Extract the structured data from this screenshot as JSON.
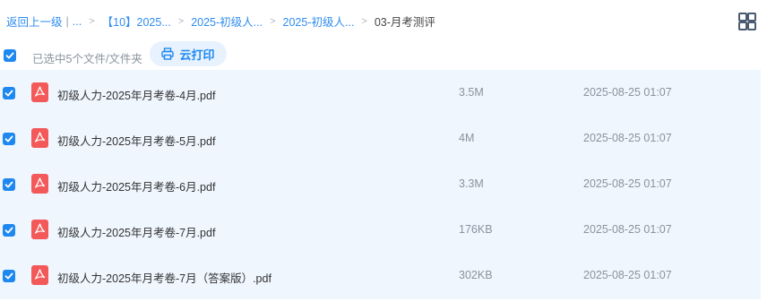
{
  "breadcrumb": {
    "back": "返回上一级",
    "divider": "|",
    "ellipsis": "...",
    "sep": ">",
    "items": [
      "【10】2025...",
      "2025-初级人...",
      "2025-初级人..."
    ],
    "current": "03-月考测评"
  },
  "selection": {
    "text": "已选中5个文件/文件夹",
    "print_label": "云打印"
  },
  "files": [
    {
      "name": "初级人力-2025年月考卷-4月.pdf",
      "size": "3.5M",
      "date": "2025-08-25 01:07"
    },
    {
      "name": "初级人力-2025年月考卷-5月.pdf",
      "size": "4M",
      "date": "2025-08-25 01:07"
    },
    {
      "name": "初级人力-2025年月考卷-6月.pdf",
      "size": "3.3M",
      "date": "2025-08-25 01:07"
    },
    {
      "name": "初级人力-2025年月考卷-7月.pdf",
      "size": "176KB",
      "date": "2025-08-25 01:07"
    },
    {
      "name": "初级人力-2025年月考卷-7月（答案版）.pdf",
      "size": "302KB",
      "date": "2025-08-25 01:07"
    }
  ],
  "colors": {
    "accent": "#1e88f0",
    "pdf": "#f45959",
    "list_bg": "#eff6fe"
  },
  "icons": [
    "check-icon",
    "printer-icon",
    "pdf-file-icon",
    "grid-view-icon"
  ]
}
